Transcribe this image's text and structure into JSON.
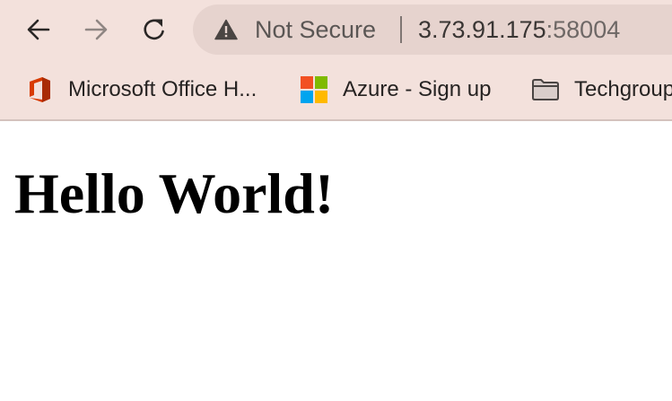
{
  "toolbar": {
    "back_icon": "arrow-left-icon",
    "forward_icon": "arrow-right-icon",
    "reload_icon": "reload-icon"
  },
  "omnibox": {
    "security_icon": "warning-triangle-icon",
    "security_label": "Not Secure",
    "host": "3.73.91.175",
    "port": ":58004"
  },
  "bookmarks": [
    {
      "label": "Microsoft Office H...",
      "icon": "microsoft-office-icon"
    },
    {
      "label": "Azure - Sign up",
      "icon": "microsoft-logo-icon"
    },
    {
      "label": "Techgroup",
      "icon": "folder-icon"
    }
  ],
  "page": {
    "heading": "Hello World!"
  },
  "colors": {
    "chrome_background": "#f3e1dc",
    "omnibox_background": "#e6d3ce",
    "ms_red": "#f25022",
    "ms_green": "#7fba00",
    "ms_blue": "#00a4ef",
    "ms_yellow": "#ffb900",
    "office_orange": "#d83b01"
  }
}
